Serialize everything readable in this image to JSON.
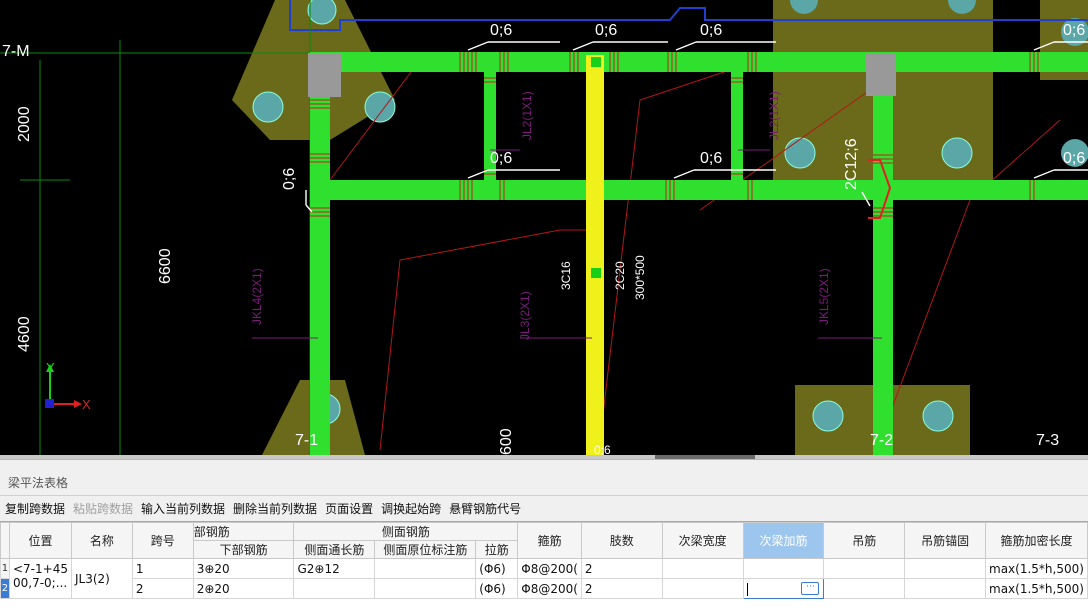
{
  "cad": {
    "grid_labels": {
      "top_left": "7-M",
      "bottom_1": "7-1",
      "bottom_2": "7-2",
      "bottom_3": "7-3"
    },
    "dimensions": {
      "d2000": "2000",
      "d6600": "6600",
      "d4600": "4600",
      "d600": "600"
    },
    "rebar_annotations": {
      "a06_1": "0;6",
      "a06_2": "0;6",
      "a06_3": "0;6",
      "a06_4": "0;6",
      "a06_5": "0;6",
      "a06_6": "0;6",
      "a06_7": "0;6",
      "a06_left": "0;6",
      "a06_bottom": "0;6",
      "c12": "2C12;6",
      "c16": "3C16",
      "c20": "2C20",
      "size": "300*500"
    },
    "beam_labels": {
      "jl2_1": "JL2(1X1)",
      "jl2_2": "JL2(1X1)",
      "jkl4": "JKL4(2X1)",
      "jl3": "JL3(2X1)",
      "jkl5": "JKL5(2X1)"
    },
    "axis": {
      "x": "X",
      "y": "Y"
    }
  },
  "panel": {
    "title": "梁平法表格",
    "toolbar": {
      "copy_span": "复制跨数据",
      "paste_span": "粘贴跨数据",
      "input_column": "输入当前列数据",
      "delete_column": "删除当前列数据",
      "page_setup": "页面设置",
      "swap_start": "调换起始跨",
      "cantilever_code": "悬臂钢筋代号"
    },
    "table": {
      "headers_top": {
        "position": "位置",
        "name": "名称",
        "span_no": "跨号",
        "bottom_group": "部钢筋",
        "side_group": "侧面钢筋",
        "stirrup": "箍筋",
        "legs": "肢数",
        "secondary_width": "次梁宽度",
        "secondary_add": "次梁加筋",
        "hanger": "吊筋",
        "hanger_anchor": "吊筋锚固",
        "stirrup_dense_len": "箍筋加密长度"
      },
      "headers_sub": {
        "bottom_rebar": "下部钢筋",
        "side_long": "侧面通长筋",
        "side_orig": "侧面原位标注筋",
        "tie": "拉筋"
      },
      "rows": [
        {
          "rownum": "1",
          "position": "<7-1+45",
          "name": "JL3(2)",
          "span_no": "1",
          "bottom_rebar": "3⊕20",
          "side_long": "G2⊕12",
          "side_orig": "",
          "tie": "(Φ6)",
          "stirrup": "Φ8@200(",
          "legs": "2",
          "secondary_width": "",
          "secondary_add": "",
          "hanger": "",
          "hanger_anchor": "",
          "stirrup_dense_len": "max(1.5*h,500)"
        },
        {
          "rownum": "2",
          "position": "00,7-0;...",
          "name": "",
          "span_no": "2",
          "bottom_rebar": "2⊕20",
          "side_long": "",
          "side_orig": "",
          "tie": "(Φ6)",
          "stirrup": "Φ8@200(",
          "legs": "2",
          "secondary_width": "",
          "secondary_add": "",
          "hanger": "",
          "hanger_anchor": "",
          "stirrup_dense_len": "max(1.5*h,500)"
        }
      ]
    }
  }
}
